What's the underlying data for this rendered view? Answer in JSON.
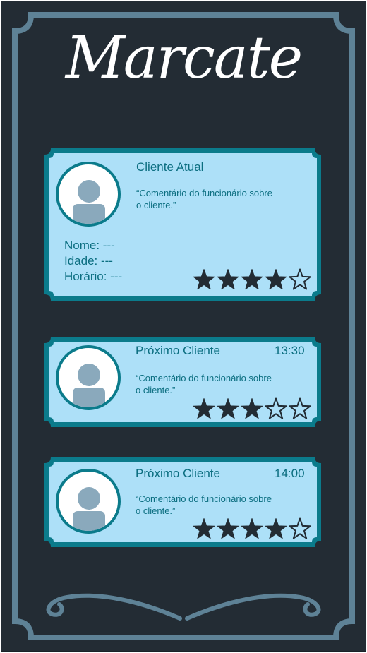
{
  "app": {
    "title": "Marcate"
  },
  "colors": {
    "background": "#232c34",
    "frame": "#5e8296",
    "card_fill": "#ade0f8",
    "card_border": "#0b7b8b",
    "text": "#0b6e80",
    "star": "#232c34"
  },
  "current_client": {
    "heading": "Cliente Atual",
    "comment": "“Comentário do funcionário sobre o cliente.”",
    "name_line": "Nome: ---",
    "age_line": "Idade: ---",
    "time_line": "Horário: ---",
    "rating": 4,
    "rating_max": 5,
    "avatar_icon": "user-avatar-icon"
  },
  "next_clients": [
    {
      "heading": "Próximo Cliente",
      "time": "13:30",
      "comment": "“Comentário do funcionário sobre o cliente.”",
      "rating": 3,
      "rating_max": 5,
      "avatar_icon": "user-avatar-icon"
    },
    {
      "heading": "Próximo Cliente",
      "time": "14:00",
      "comment": "“Comentário do funcionário sobre o cliente.”",
      "rating": 4,
      "rating_max": 5,
      "avatar_icon": "user-avatar-icon"
    }
  ]
}
